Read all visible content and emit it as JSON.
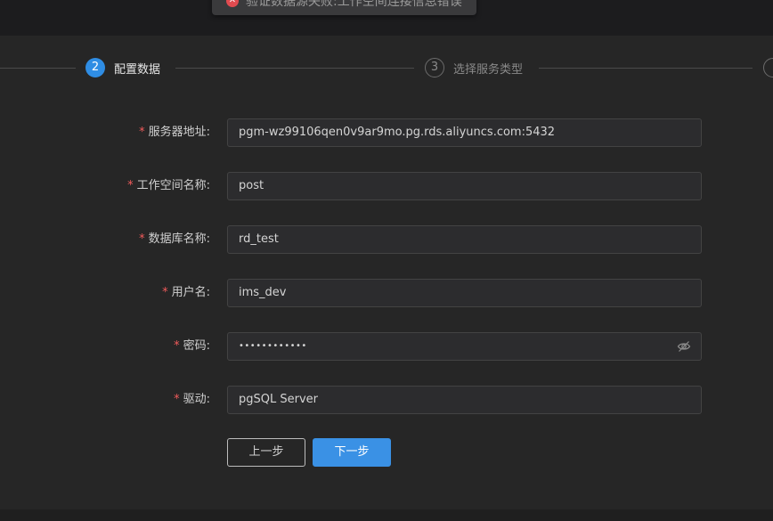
{
  "toast": {
    "message": "验证数据源失败:工作空间连接信息错误",
    "icon": "error-icon",
    "color": "#e14b50"
  },
  "steps": [
    {
      "number": "2",
      "label": "配置数据",
      "status": "active"
    },
    {
      "number": "3",
      "label": "选择服务类型",
      "status": "wait"
    }
  ],
  "form": {
    "required_mark": "*",
    "server": {
      "label": "服务器地址:",
      "value": "pgm-wz99106qen0v9ar9mo.pg.rds.aliyuncs.com:5432"
    },
    "workspace": {
      "label": "工作空间名称:",
      "value": "post"
    },
    "database": {
      "label": "数据库名称:",
      "value": "rd_test"
    },
    "username": {
      "label": "用户名:",
      "value": "ims_dev"
    },
    "password": {
      "label": "密码:",
      "value": "••••••••••••",
      "toggle_icon": "eye-hidden-icon"
    },
    "driver": {
      "label": "驱动:",
      "value": "pgSQL Server"
    }
  },
  "buttons": {
    "prev": "上一步",
    "next": "下一步"
  },
  "colors": {
    "accent": "#2f8de4",
    "required": "#f15b5b",
    "background": "#262626"
  }
}
